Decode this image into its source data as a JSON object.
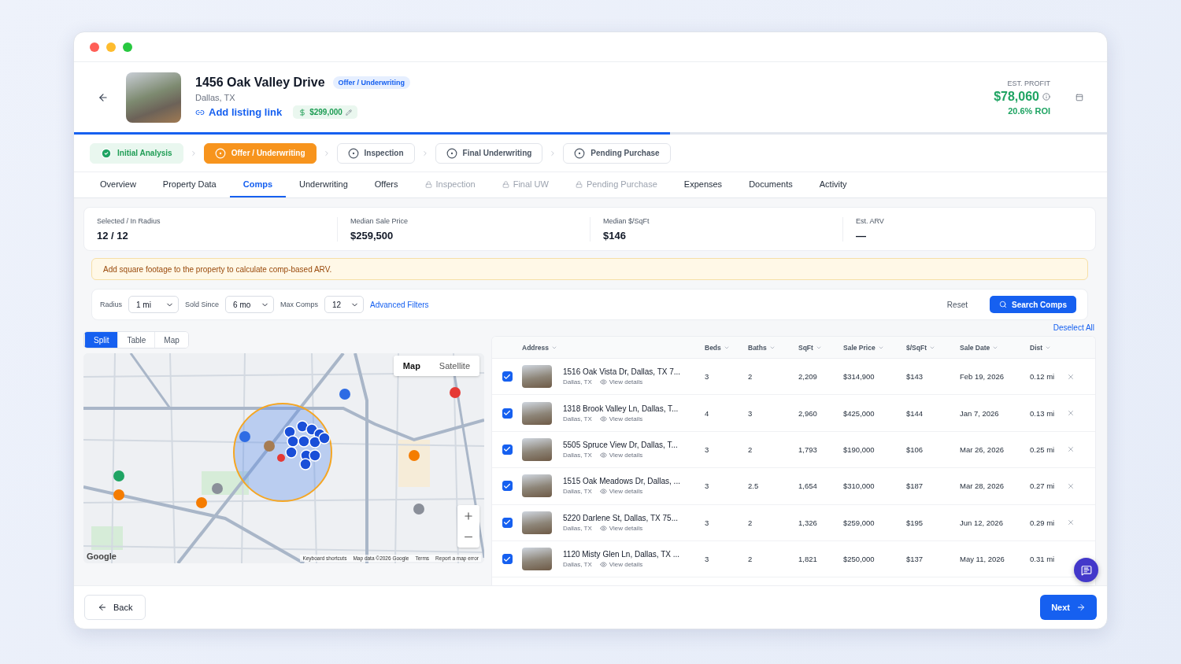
{
  "header": {
    "title": "1456 Oak Valley Drive",
    "status_badge": "Offer / Underwriting",
    "location": "Dallas, TX",
    "listing_link": "Add listing link",
    "price": "$299,000",
    "profit_label": "EST. PROFIT",
    "profit_value": "$78,060",
    "roi": "20.6% ROI"
  },
  "progress": {
    "level": 0.577
  },
  "stages": [
    {
      "label": "Initial Analysis",
      "kind": "done"
    },
    {
      "label": "Offer / Underwriting",
      "kind": "current"
    },
    {
      "label": "Inspection",
      "kind": "upcoming"
    },
    {
      "label": "Final Underwriting",
      "kind": "upcoming"
    },
    {
      "label": "Pending Purchase",
      "kind": "upcoming"
    }
  ],
  "tabs": [
    {
      "label": "Overview",
      "selected": false,
      "locked": false
    },
    {
      "label": "Property Data",
      "selected": false,
      "locked": false
    },
    {
      "label": "Comps",
      "selected": true,
      "locked": false
    },
    {
      "label": "Underwriting",
      "selected": false,
      "locked": false
    },
    {
      "label": "Offers",
      "selected": false,
      "locked": false
    },
    {
      "label": "Inspection",
      "selected": false,
      "locked": true
    },
    {
      "label": "Final UW",
      "selected": false,
      "locked": true
    },
    {
      "label": "Pending Purchase",
      "selected": false,
      "locked": true
    },
    {
      "label": "Expenses",
      "selected": false,
      "locked": false
    },
    {
      "label": "Documents",
      "selected": false,
      "locked": false
    },
    {
      "label": "Activity",
      "selected": false,
      "locked": false
    }
  ],
  "stats": [
    {
      "label": "Selected / In Radius",
      "value": "12 / 12"
    },
    {
      "label": "Median Sale Price",
      "value": "$259,500"
    },
    {
      "label": "Median $/SqFt",
      "value": "$146"
    },
    {
      "label": "Est. ARV",
      "value": "—"
    }
  ],
  "alert": "Add square footage to the property to calculate comp-based ARV.",
  "filters": {
    "fields": [
      {
        "label": "Radius",
        "value": "1 mi"
      },
      {
        "label": "Sold Since",
        "value": "6 mo"
      },
      {
        "label": "Max Comps",
        "value": "12"
      }
    ],
    "advanced": "Advanced Filters",
    "reset": "Reset",
    "search": "Search Comps"
  },
  "view_modes": [
    {
      "label": "Split",
      "selected": true
    },
    {
      "label": "Table",
      "selected": false
    },
    {
      "label": "Map",
      "selected": false
    }
  ],
  "deselect_all": "Deselect All",
  "map": {
    "types": [
      {
        "label": "Map",
        "selected": true
      },
      {
        "label": "Satellite",
        "selected": false
      }
    ],
    "logo": "Google",
    "attribution": [
      "Keyboard shortcuts",
      "Map data ©2026 Google",
      "Terms",
      "Report a map error"
    ]
  },
  "table": {
    "address_column": "Address",
    "columns": [
      "Beds",
      "Baths",
      "SqFt",
      "Sale Price",
      "$/SqFt",
      "Sale Date",
      "Dist"
    ],
    "rows": [
      {
        "checked": true,
        "address": "1516 Oak Vista Dr, Dallas, TX 7...",
        "city": "Dallas, TX",
        "link": "View details",
        "cells": [
          "3",
          "2",
          "2,209",
          "$314,900",
          "$143",
          "Feb 19, 2026",
          "0.12 mi"
        ],
        "removable": true
      },
      {
        "checked": true,
        "address": "1318 Brook Valley Ln, Dallas, T...",
        "city": "Dallas, TX",
        "link": "View details",
        "cells": [
          "4",
          "3",
          "2,960",
          "$425,000",
          "$144",
          "Jan 7, 2026",
          "0.13 mi"
        ],
        "removable": true
      },
      {
        "checked": true,
        "address": "5505 Spruce View Dr, Dallas, T...",
        "city": "Dallas, TX",
        "link": "View details",
        "cells": [
          "3",
          "2",
          "1,793",
          "$190,000",
          "$106",
          "Mar 26, 2026",
          "0.25 mi"
        ],
        "removable": true
      },
      {
        "checked": true,
        "address": "1515 Oak Meadows Dr, Dallas, ...",
        "city": "Dallas, TX",
        "link": "View details",
        "cells": [
          "3",
          "2.5",
          "1,654",
          "$310,000",
          "$187",
          "Mar 28, 2026",
          "0.27 mi"
        ],
        "removable": true
      },
      {
        "checked": true,
        "address": "5220 Darlene St, Dallas, TX 75...",
        "city": "Dallas, TX",
        "link": "View details",
        "cells": [
          "3",
          "2",
          "1,326",
          "$259,000",
          "$195",
          "Jun 12, 2026",
          "0.29 mi"
        ],
        "removable": true
      },
      {
        "checked": true,
        "address": "1120 Misty Glen Ln, Dallas, TX ...",
        "city": "Dallas, TX",
        "link": "View details",
        "cells": [
          "3",
          "2",
          "1,821",
          "$250,000",
          "$137",
          "May 11, 2026",
          "0.31 mi"
        ],
        "removable": false
      }
    ]
  },
  "footer": {
    "back": "Back",
    "next": "Next"
  }
}
